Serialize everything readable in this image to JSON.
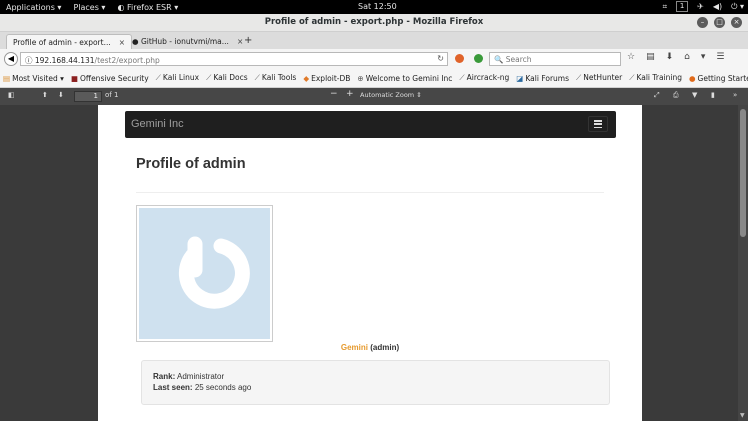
{
  "system_bar": {
    "applications": "Applications ▾",
    "places": "Places ▾",
    "firefox": "Firefox ESR ▾",
    "clock": "Sat 12:50",
    "workspace": "1"
  },
  "window": {
    "title": "Profile of admin - export.php - Mozilla Firefox"
  },
  "tabs": [
    {
      "label": "Profile of admin - export...",
      "close": "×"
    },
    {
      "label": "GitHub - ionutvmi/ma...",
      "close": "×"
    }
  ],
  "new_tab": "+",
  "url": {
    "host": "192.168.44.131",
    "path": "/test2/export.php"
  },
  "search": {
    "placeholder": "Search"
  },
  "bookmarks": [
    "Most Visited",
    "Offensive Security",
    "Kali Linux",
    "Kali Docs",
    "Kali Tools",
    "Exploit-DB",
    "Welcome to Gemini Inc",
    "Aircrack-ng",
    "Kali Forums",
    "NetHunter",
    "Kali Training",
    "Getting Started"
  ],
  "pdf_toolbar": {
    "page_number": "1",
    "page_count": "of 1",
    "zoom": "Automatic Zoom"
  },
  "page": {
    "brand": "Gemini Inc",
    "heading": "Profile of admin",
    "user_name": "Gemini",
    "user_handle": "(admin)",
    "rank_label": "Rank:",
    "rank_value": "Administrator",
    "last_seen_label": "Last seen:",
    "last_seen_value": "25 seconds ago"
  },
  "colors": {
    "brand_nav": "#1f1f1f",
    "user_name": "#e69a2e",
    "avatar_bg": "#cfe1ef"
  }
}
